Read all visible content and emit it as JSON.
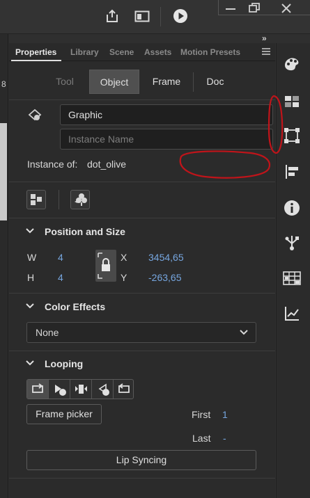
{
  "toolbar": {
    "icons": [
      "share-icon",
      "panel-toggle-icon",
      "play-icon"
    ],
    "window_controls": [
      "minimize-icon",
      "restore-icon",
      "close-icon"
    ],
    "collapse_glyph": "»"
  },
  "left_strip": {
    "ruler_text": "8"
  },
  "panel": {
    "tabs": [
      {
        "label": "Properties",
        "active": true
      },
      {
        "label": "Library",
        "active": false
      },
      {
        "label": "Scene",
        "active": false
      },
      {
        "label": "Assets",
        "active": false
      },
      {
        "label": "Motion Presets",
        "active": false
      }
    ],
    "menu_icon": "hamburger-icon",
    "segments": [
      {
        "label": "Tool",
        "state": "disabled"
      },
      {
        "label": "Object",
        "state": "selected"
      },
      {
        "label": "Frame",
        "state": "normal"
      },
      {
        "label": "Doc",
        "state": "normal"
      }
    ],
    "symbol": {
      "type_value": "Graphic",
      "instance_name_placeholder": "Instance Name",
      "instance_of_label": "Instance of:",
      "instance_of_value": "dot_olive"
    },
    "position_size": {
      "title": "Position and Size",
      "w_label": "W",
      "w_value": "4",
      "h_label": "H",
      "h_value": "4",
      "x_label": "X",
      "x_value": "3454,65",
      "y_label": "Y",
      "y_value": "-263,65"
    },
    "color_effects": {
      "title": "Color Effects",
      "selected": "None"
    },
    "looping": {
      "title": "Looping",
      "frame_picker_label": "Frame picker",
      "first_label": "First",
      "first_value": "1",
      "last_label": "Last",
      "last_value": "-",
      "lip_sync_label": "Lip Syncing"
    }
  },
  "right_rail": {
    "icons": [
      "palette-icon",
      "swatches-icon",
      "transform-icon",
      "align-icon",
      "info-icon",
      "component-icon",
      "frames-icon",
      "chart-icon"
    ]
  },
  "colors": {
    "accent_blue": "#76a6df",
    "annotation_red": "#c0141a",
    "panel_bg": "#2b2b2b"
  }
}
